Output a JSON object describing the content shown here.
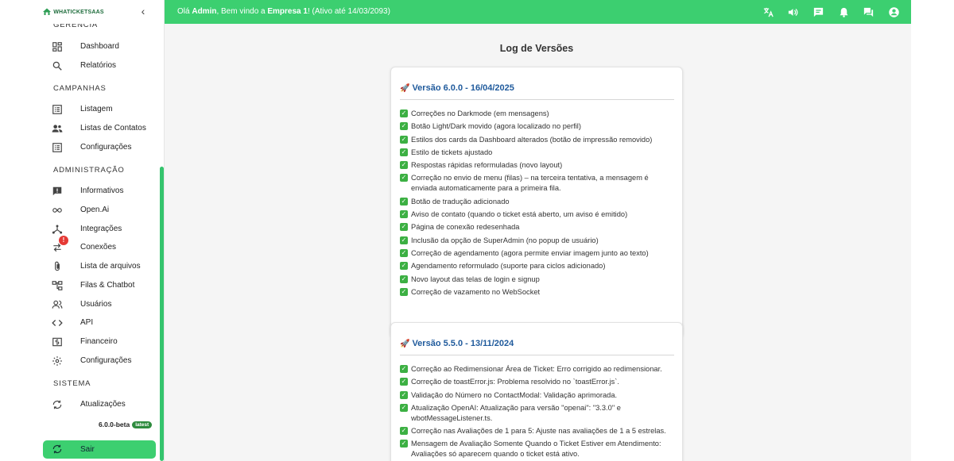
{
  "app": {
    "logo_text": "WHATICKETSAAS",
    "collapse_icon": "chevron-left-icon"
  },
  "topbar": {
    "greeting_prefix": "Olá ",
    "user": "Admin",
    "greeting_mid": ", Bem vindo a ",
    "company": "Empresa 1",
    "greeting_suffix": "! (Ativo até 14/03/2093)",
    "icons": [
      "translate-icon",
      "volume-icon",
      "chat-icon",
      "bell-icon",
      "forum-icon",
      "account-circle-icon"
    ]
  },
  "sidebar": {
    "sections": {
      "gerencia": "GERÊNCIA",
      "campanhas": "CAMPANHAS",
      "administracao": "ADMINISTRAÇÃO",
      "sistema": "SISTEMA"
    },
    "items": {
      "dashboard": {
        "label": "Dashboard",
        "icon": "dashboard-icon"
      },
      "relatorios": {
        "label": "Relatórios",
        "icon": "search-icon"
      },
      "listagem": {
        "label": "Listagem",
        "icon": "list-icon"
      },
      "listas_contatos": {
        "label": "Listas de Contatos",
        "icon": "people-icon"
      },
      "configuracoes_campanha": {
        "label": "Configurações",
        "icon": "list-settings-icon"
      },
      "informativos": {
        "label": "Informativos",
        "icon": "announcement-icon"
      },
      "openai": {
        "label": "Open.Ai",
        "icon": "infinity-icon"
      },
      "integracoes": {
        "label": "Integrações",
        "icon": "hub-icon"
      },
      "conexoes": {
        "label": "Conexões",
        "icon": "swap-icon",
        "badge": "!"
      },
      "lista_arquivos": {
        "label": "Lista de arquivos",
        "icon": "attach-icon"
      },
      "filas_chatbot": {
        "label": "Filas & Chatbot",
        "icon": "flow-icon"
      },
      "usuarios": {
        "label": "Usuários",
        "icon": "users-icon"
      },
      "api": {
        "label": "API",
        "icon": "code-icon"
      },
      "financeiro": {
        "label": "Financeiro",
        "icon": "money-icon"
      },
      "configuracoes": {
        "label": "Configurações",
        "icon": "gear-icon"
      },
      "atualizacoes": {
        "label": "Atualizações",
        "icon": "sync-icon"
      }
    },
    "version": "6.0.0-beta",
    "version_tag": "latest",
    "logout": {
      "label": "Sair",
      "icon": "sync-icon"
    }
  },
  "main": {
    "title": "Log de Versões",
    "releases": [
      {
        "title": "Versão 6.0.0 - 16/04/2025",
        "items": [
          "Correções no Darkmode (em mensagens)",
          "Botão Light/Dark movido (agora localizado no perfil)",
          "Estilos dos cards da Dashboard alterados (botão de impressão removido)",
          "Estilo de tickets ajustado",
          "Respostas rápidas reformuladas (novo layout)",
          "Correção no envio de menu (filas) – na terceira tentativa, a mensagem é enviada automaticamente para a primeira fila.",
          "Botão de tradução adicionado",
          "Aviso de contato (quando o ticket está aberto, um aviso é emitido)",
          "Página de conexão redesenhada",
          "Inclusão da opção de SuperAdmin (no popup de usuário)",
          "Correção de agendamento (agora permite enviar imagem junto ao texto)",
          "Agendamento reformulado (suporte para ciclos adicionado)",
          "Novo layout das telas de login e signup",
          "Correção de vazamento no WebSocket"
        ]
      },
      {
        "title": "Versão 5.5.0 - 13/11/2024",
        "items": [
          "Correção ao Redimensionar Área de Ticket: Erro corrigido ao redimensionar.",
          "Correção de toastError.js: Problema resolvido no `toastError.js`.",
          "Validação do Número no ContactModal: Validação aprimorada.",
          "Atualização OpenAI: Atualização para versão \"openai\": \"3.3.0\" e wbotMessageListener.ts.",
          "Correção nas Avaliações de 1 para 5: Ajuste nas avaliações de 1 a 5 estrelas.",
          "Mensagem de Avaliação Somente Quando o Ticket Estiver em Atendimento: Avaliações só aparecem quando o ticket está ativo."
        ]
      }
    ]
  }
}
